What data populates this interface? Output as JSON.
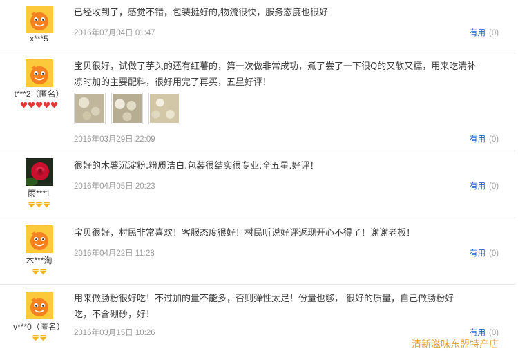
{
  "colors": {
    "link": "#1e5ec8",
    "date": "#9a9a9a",
    "watermark": "#e6a33a",
    "badge_red": "#e83838",
    "badge_gold": "#f2b41c"
  },
  "reviews": [
    {
      "user": "x***5",
      "avatar": "taobao-mascot-avatar",
      "badge_count": 0,
      "text": "已经收到了，感觉不错，包装挺好的,物流很快，服务态度也很好",
      "date": "2016年07月04日 01:47",
      "useful_label": "有用",
      "useful_count": "(0)"
    },
    {
      "user": "t***2（匿名）",
      "avatar": "taobao-mascot-avatar",
      "badge_type": "red-heart",
      "badge_count": 5,
      "text_lines": [
        "宝贝很好，试做了芋头的还有红薯的，第一次做非常成功，煮了尝了一下很Q的又软又糯，用来吃清补",
        "凉时加的主要配料，很好用完了再买，五星好评！"
      ],
      "photos": [
        "photo-powder-1",
        "photo-powder-2",
        "photo-powder-3"
      ],
      "date": "2016年03月29日 22:09",
      "useful_label": "有用",
      "useful_count": "(0)"
    },
    {
      "user": "雨***1",
      "avatar": "rose-photo-avatar",
      "badge_type": "gold-diamond",
      "badge_count": 3,
      "text": "很好的木薯沉淀粉.粉质洁白.包装很结实很专业.全五星.好评！",
      "date": "2016年04月05日 20:23",
      "useful_label": "有用",
      "useful_count": "(0)"
    },
    {
      "user": "木***淘",
      "avatar": "taobao-mascot-avatar",
      "badge_type": "gold-diamond",
      "badge_count": 2,
      "text": "宝贝很好，村民非常喜欢！客服态度很好！村民听说好评返现开心不得了！谢谢老板！",
      "date": "2016年04月22日 11:28",
      "useful_label": "有用",
      "useful_count": "(0)"
    },
    {
      "user": "v***0（匿名）",
      "avatar": "taobao-mascot-avatar",
      "badge_type": "gold-diamond",
      "badge_count": 2,
      "text_lines": [
        "用来做肠粉很好吃！不过加的量不能多，否则弹性太足！份量也够， 很好的质量，自己做肠粉好",
        "吃，不含硼砂，好！"
      ],
      "date": "2016年03月15日 10:26",
      "useful_label": "有用",
      "useful_count": "(0)"
    }
  ],
  "watermark": "清新滋味东盟特产店"
}
